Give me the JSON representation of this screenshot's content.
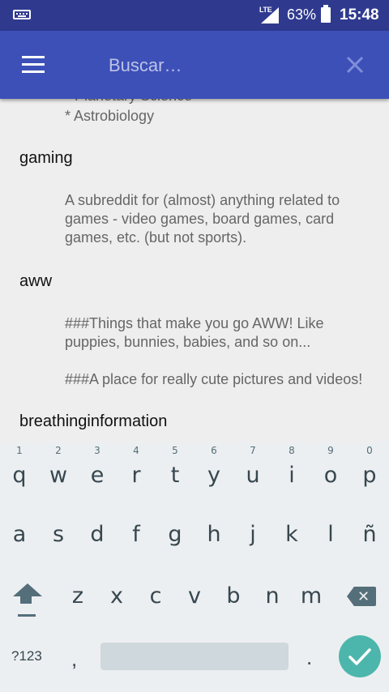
{
  "status_bar": {
    "network": "LTE",
    "battery_percent": "63%",
    "time": "15:48",
    "icons": [
      "keyboard-icon",
      "signal-icon",
      "battery-icon"
    ]
  },
  "toolbar": {
    "search_placeholder": "Buscar…",
    "search_value": "",
    "icons": [
      "menu-icon",
      "close-icon"
    ],
    "color": "#3d50b8"
  },
  "list": {
    "partial_line": "* Planetary Science",
    "partial_line_2": "* Astrobiology",
    "items": [
      {
        "name": "gaming",
        "description": [
          "A subreddit for (almost) anything related to",
          "games - video games, board games, card",
          "games, etc. (but not sports)."
        ]
      },
      {
        "name": "aww",
        "description": [
          "###Things that make you go AWW! Like",
          "puppies, bunnies, babies, and so on...",
          "",
          "###A place for really cute pictures and videos!"
        ]
      },
      {
        "name": "breathinginformation",
        "description": []
      }
    ]
  },
  "keyboard": {
    "row1": [
      "q",
      "w",
      "e",
      "r",
      "t",
      "y",
      "u",
      "i",
      "o",
      "p"
    ],
    "row1_hints": [
      "1",
      "2",
      "3",
      "4",
      "5",
      "6",
      "7",
      "8",
      "9",
      "0"
    ],
    "row2": [
      "a",
      "s",
      "d",
      "f",
      "g",
      "h",
      "j",
      "k",
      "l",
      "ñ"
    ],
    "row3": [
      "z",
      "x",
      "c",
      "v",
      "b",
      "n",
      "m"
    ],
    "symbols_label": "?123",
    "comma": ",",
    "period": ".",
    "enter_color": "#4db6ac"
  }
}
